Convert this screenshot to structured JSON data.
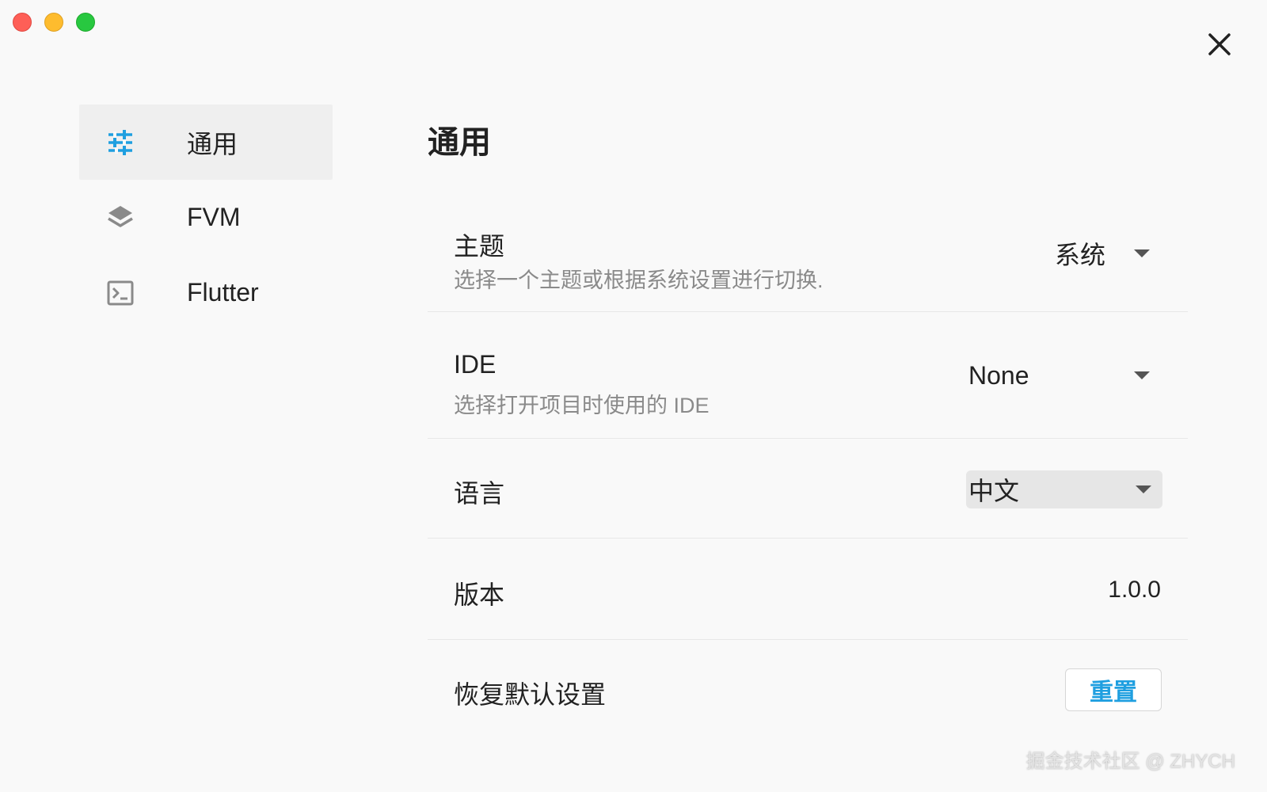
{
  "window": {
    "controls": [
      "close",
      "minimize",
      "maximize"
    ]
  },
  "sidebar": {
    "items": [
      {
        "label": "通用",
        "icon": "sliders-icon",
        "active": true
      },
      {
        "label": "FVM",
        "icon": "layers-icon",
        "active": false
      },
      {
        "label": "Flutter",
        "icon": "terminal-icon",
        "active": false
      }
    ]
  },
  "main": {
    "title": "通用",
    "settings": {
      "theme": {
        "title": "主题",
        "description": "选择一个主题或根据系统设置进行切换.",
        "value": "系统"
      },
      "ide": {
        "title": "IDE",
        "description": "选择打开项目时使用的 IDE",
        "value": "None"
      },
      "language": {
        "title": "语言",
        "value": "中文"
      },
      "version": {
        "title": "版本",
        "value": "1.0.0"
      },
      "reset": {
        "title": "恢复默认设置",
        "button_label": "重置"
      }
    }
  },
  "watermark": "掘金技术社区 @ ZHYCH",
  "colors": {
    "accent": "#1f9fe0",
    "active_nav_bg": "#efefef",
    "description_text": "#8a8a8a"
  }
}
